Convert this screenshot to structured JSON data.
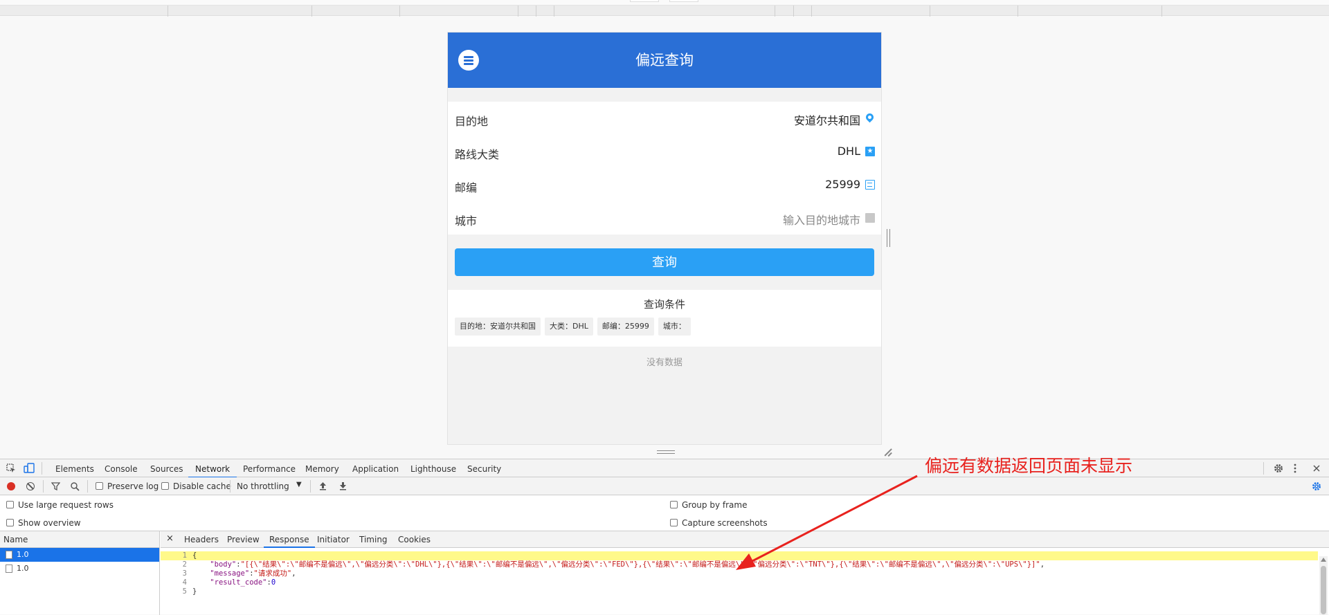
{
  "app": {
    "title": "偏远查询",
    "form": [
      {
        "label": "目的地",
        "value": "安道尔共和国",
        "icon": "location-pin-icon"
      },
      {
        "label": "路线大类",
        "value": "DHL",
        "icon": "star-badge-icon"
      },
      {
        "label": "邮编",
        "value": "25999",
        "icon": "postcode-icon"
      },
      {
        "label": "城市",
        "placeholder": "输入目的地城市",
        "icon": "building-icon"
      }
    ],
    "query_button": "查询",
    "conditions": {
      "title": "查询条件",
      "chips": [
        "目的地：安道尔共和国",
        "大类：DHL",
        "邮编：25999",
        "城市："
      ]
    },
    "no_data": "没有数据",
    "accent": "#2a6fd6",
    "button_color": "#2aa0f5"
  },
  "devtools": {
    "tabs": [
      "Elements",
      "Console",
      "Sources",
      "Network",
      "Performance",
      "Memory",
      "Application",
      "Lighthouse",
      "Security"
    ],
    "active_tab": "Network",
    "toolbar": {
      "preserve_log": "Preserve log",
      "disable_cache": "Disable cache",
      "throttling": "No throttling"
    },
    "options": {
      "large_rows": "Use large request rows",
      "show_overview": "Show overview",
      "group_by_frame": "Group by frame",
      "capture_screenshots": "Capture screenshots"
    },
    "list_header": "Name",
    "requests": [
      "1.0",
      "1.0"
    ],
    "detail_tabs": [
      "Headers",
      "Preview",
      "Response",
      "Initiator",
      "Timing",
      "Cookies"
    ],
    "active_detail_tab": "Response",
    "close_symbol": "×",
    "response_lines": [
      {
        "num": "1",
        "text": "{"
      },
      {
        "num": "2",
        "key": "\"body\"",
        "value": "\"[{\\\"结果\\\":\\\"邮编不是偏远\\\",\\\"偏远分类\\\":\\\"DHL\\\"},{\\\"结果\\\":\\\"邮编不是偏远\\\",\\\"偏远分类\\\":\\\"FED\\\"},{\\\"结果\\\":\\\"邮编不是偏远\\\",\\\"偏远分类\\\":\\\"TNT\\\"},{\\\"结果\\\":\\\"邮编不是偏远\\\",\\\"偏远分类\\\":\\\"UPS\\\"}]\"",
        "trail": ","
      },
      {
        "num": "3",
        "key": "\"message\"",
        "value": "\"请求成功\"",
        "trail": ","
      },
      {
        "num": "4",
        "key": "\"result_code\"",
        "number": "0"
      },
      {
        "num": "5",
        "text": "}"
      }
    ]
  },
  "annotation": {
    "text": "偏远有数据返回页面未显示",
    "color": "#e8221e"
  }
}
